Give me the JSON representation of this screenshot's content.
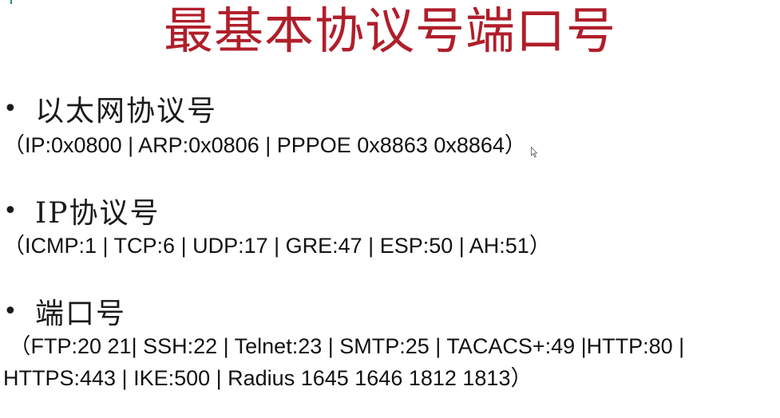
{
  "title": "最基本协议号端口号",
  "sections": [
    {
      "bullet": "•",
      "heading": "以太网协议号",
      "detail": "（IP:0x0800 | ARP:0x0806 | PPPOE 0x8863 0x8864）"
    },
    {
      "bullet": "•",
      "heading": "IP协议号",
      "detail": "（ICMP:1 | TCP:6 | UDP:17 | GRE:47 | ESP:50 | AH:51）"
    },
    {
      "bullet": "•",
      "heading": "端口号",
      "detail_line1": " （FTP:20 21| SSH:22 | Telnet:23 | SMTP:25 | TACACS+:49 |HTTP:80 |",
      "detail_line2": "HTTPS:443 | IKE:500 | Radius 1645 1646 1812 1813）"
    }
  ],
  "colors": {
    "title": "#b01e2a",
    "text": "#1a1a1a"
  },
  "icons": {
    "cursor": "mouse-pointer-icon"
  }
}
